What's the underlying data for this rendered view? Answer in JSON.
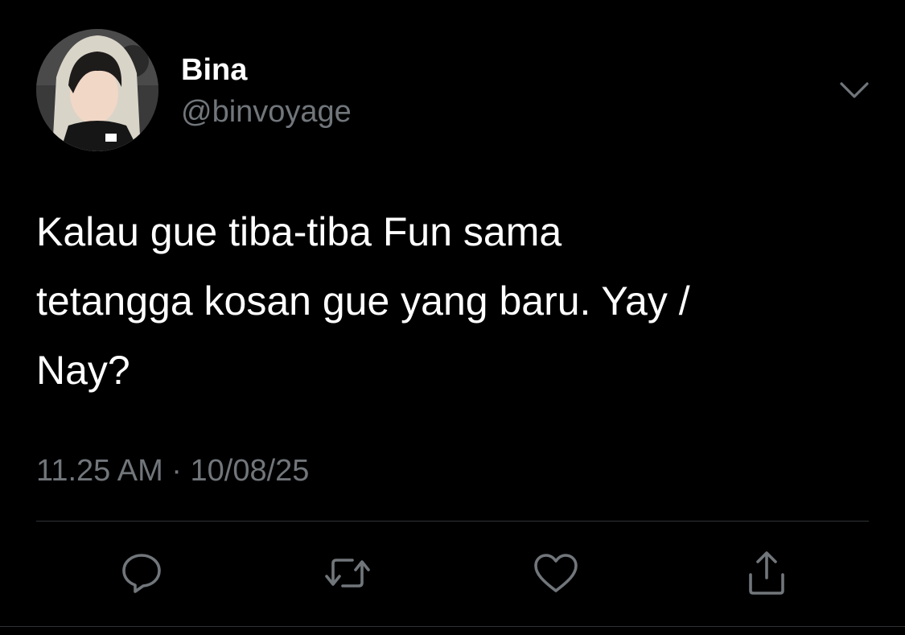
{
  "user": {
    "display_name": "Bina",
    "handle": "@binvoyage"
  },
  "tweet": {
    "lines": [
      "Kalau gue tiba-tiba Fun sama",
      "tetangga kosan gue yang baru. Yay /",
      "Nay?"
    ],
    "time": "11.25 AM",
    "separator": "·",
    "date": "10/08/25"
  },
  "actions": {
    "reply_icon": "reply-icon",
    "retweet_icon": "retweet-icon",
    "like_icon": "heart-icon",
    "share_icon": "share-icon"
  },
  "colors": {
    "background": "#000000",
    "primary_text": "#ffffff",
    "secondary_text": "#71767b",
    "divider": "#2f3336"
  }
}
